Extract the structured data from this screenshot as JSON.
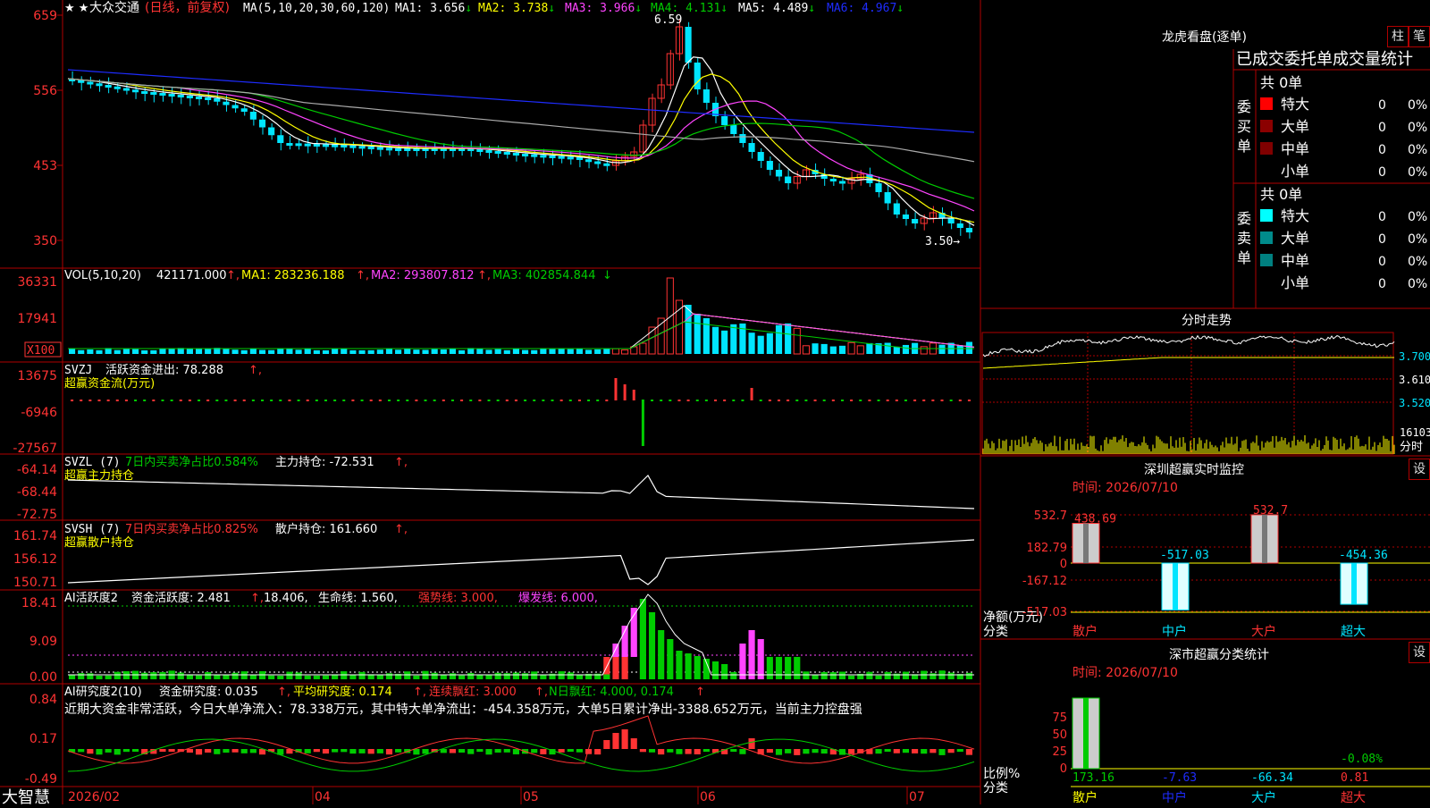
{
  "colors": {
    "up": "#ff3333",
    "down": "#00e5ff",
    "bg": "#000000",
    "frame": "#b00000",
    "white": "#ffffff",
    "yellow": "#ffff00",
    "magenta": "#ff44ff",
    "green": "#00cc00",
    "blue": "#1e2cff",
    "gray": "#aaaaaa",
    "teal": "#008080",
    "darkred": "#800000"
  },
  "app": {
    "brand": "大智慧"
  },
  "kline": {
    "stock": "大众交通",
    "period": "(日线，前复权)",
    "ma_group": "MA(5,10,20,30,60,120)",
    "ma": [
      {
        "label": "MA1: 3.656",
        "arrow": "↓"
      },
      {
        "label": "MA2: 3.738",
        "arrow": "↓"
      },
      {
        "label": "MA3: 3.966",
        "arrow": "↓"
      },
      {
        "label": "MA4: 4.131",
        "arrow": "↓"
      },
      {
        "label": "MA5: 4.489",
        "arrow": "↓"
      },
      {
        "label": "MA6: 4.967",
        "arrow": "↓"
      }
    ],
    "y_ticks": [
      "659",
      "556",
      "453",
      "350"
    ],
    "high_label": "6.59",
    "low_label": "3.50→",
    "stars": "★ ★"
  },
  "vol": {
    "title": "VOL(5,10,20)",
    "value": "421171.000",
    "ma1": "MA1: 283236.188",
    "ma2": "MA2: 293807.812",
    "ma3": "MA3: 402854.844",
    "ticks": [
      "36331",
      "17941"
    ],
    "unit": "X100"
  },
  "svzj": {
    "title": "SVZJ",
    "label": "活跃资金进出: 78.288",
    "sub": "超赢资金流(万元)",
    "ticks": [
      "13675",
      "-6946",
      "-27567"
    ]
  },
  "svzl": {
    "title": "SVZL (7)",
    "label1": "7日内买卖净占比0.584%",
    "label2": "主力持仓: -72.531",
    "sub": "超赢主力持仓",
    "ticks": [
      "-64.14",
      "-68.44",
      "-72.75"
    ]
  },
  "svsh": {
    "title": "SVSH (7)",
    "label1": "7日内买卖净占比0.825%",
    "label2": "散户持仓: 161.660",
    "sub": "超赢散户持仓",
    "ticks": [
      "161.74",
      "156.12",
      "150.71"
    ]
  },
  "ai1": {
    "title": "AI活跃度2",
    "l1": "资金活跃度: 2.481",
    "l2": "18.406,",
    "l3": "生命线: 1.560,",
    "l4": "强势线: 3.000,",
    "l5": "爆发线: 6.000,",
    "ticks": [
      "18.41",
      "9.09",
      "0.00"
    ]
  },
  "ai2": {
    "title": "AI研究度2(10)",
    "l1": "资金研究度: 0.035",
    "l2": "平均研究度: 0.174",
    "l3": "连续飘红: 3.000",
    "l4": "N日飘红: 4.000, 0.174",
    "summary": "近期大资金非常活跃，今日大单净流入：78.338万元，其中特大单净流出：-454.358万元，大单5日累计净出-3388.652万元，当前主力控盘强",
    "ticks": [
      "0.84",
      "0.17",
      "-0.49"
    ]
  },
  "xaxis": {
    "labels": [
      "2026/02",
      "04",
      "05",
      "06",
      "07"
    ]
  },
  "lhb": {
    "title": "龙虎看盘(逐单)",
    "btn1": "柱",
    "btn2": "笔",
    "header": "已成交委托单成交量统计",
    "buy": {
      "side": "委买单",
      "total": "共 0单",
      "rows": [
        {
          "name": "特大",
          "v": "0",
          "p": "0%",
          "c": "#ff0000"
        },
        {
          "name": "大单",
          "v": "0",
          "p": "0%",
          "c": "#8b0000"
        },
        {
          "name": "中单",
          "v": "0",
          "p": "0%",
          "c": "#800000"
        },
        {
          "name": "小单",
          "v": "0",
          "p": "0%",
          "c": "#000000"
        }
      ]
    },
    "sell": {
      "side": "委卖单",
      "total": "共 0单",
      "rows": [
        {
          "name": "特大",
          "v": "0",
          "p": "0%",
          "c": "#00ffff"
        },
        {
          "name": "大单",
          "v": "0",
          "p": "0%",
          "c": "#008b8b"
        },
        {
          "name": "中单",
          "v": "0",
          "p": "0%",
          "c": "#008080"
        },
        {
          "name": "小单",
          "v": "0",
          "p": "0%",
          "c": "#000000"
        }
      ]
    }
  },
  "fenshi": {
    "title": "分时走势",
    "prices": [
      "3.700",
      "3.610",
      "3.520"
    ],
    "vol_tick": "16103",
    "unit": "分时"
  },
  "monitor": {
    "title": "深圳超赢实时监控",
    "btn": "设",
    "time": "时间: 2026/07/10",
    "yticks": [
      "532.7",
      "182.79",
      "0",
      "-167.12",
      "-517.03"
    ],
    "ylabel1": "净额(万元)",
    "ylabel2": "分类",
    "bars": [
      {
        "cat": "散户",
        "value": 438.69,
        "label": "438.69"
      },
      {
        "cat": "中户",
        "value": -517.03,
        "label": "-517.03"
      },
      {
        "cat": "大户",
        "value": 532.7,
        "label": "532.7"
      },
      {
        "cat": "超大",
        "value": -454.36,
        "label": "-454.36"
      }
    ]
  },
  "classify": {
    "title": "深市超赢分类统计",
    "btn": "设",
    "time": "时间: 2026/07/10",
    "yticks": [
      "75",
      "50",
      "25",
      "0"
    ],
    "ylabel1": "比例%",
    "ylabel2": "分类",
    "bars": [
      {
        "cat": "散户",
        "value": 173.16,
        "label": "173.16"
      },
      {
        "cat": "中户",
        "value": -7.63,
        "label": "-7.63"
      },
      {
        "cat": "大户",
        "value": -66.34,
        "label": "-66.34"
      },
      {
        "cat": "超大",
        "value": 0.81,
        "label": "0.81"
      }
    ],
    "extra_label": "-0.08%"
  }
}
